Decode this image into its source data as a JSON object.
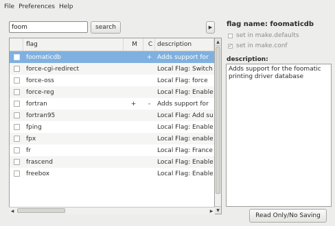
{
  "menu": {
    "file": "File",
    "preferences": "Preferences",
    "help": "Help"
  },
  "search": {
    "value": "foom",
    "button_label": "search"
  },
  "table": {
    "columns": [
      "flag",
      "M",
      "C",
      "description"
    ],
    "rows": [
      {
        "flag": "foomaticdb",
        "m": "",
        "c": "+",
        "desc": "Adds support for",
        "selected": true
      },
      {
        "flag": "force-cgi-redirect",
        "m": "",
        "c": "",
        "desc": "Local Flag: Switch"
      },
      {
        "flag": "force-oss",
        "m": "",
        "c": "",
        "desc": "Local Flag: force"
      },
      {
        "flag": "force-reg",
        "m": "",
        "c": "",
        "desc": "Local Flag: Enable"
      },
      {
        "flag": "fortran",
        "m": "+",
        "c": "-",
        "desc": "Adds support for"
      },
      {
        "flag": "fortran95",
        "m": "",
        "c": "",
        "desc": "Local Flag: Add su"
      },
      {
        "flag": "fping",
        "m": "",
        "c": "",
        "desc": "Local Flag: Enable"
      },
      {
        "flag": "fpx",
        "m": "",
        "c": "",
        "desc": "Local Flag: enable"
      },
      {
        "flag": "fr",
        "m": "",
        "c": "",
        "desc": "Local Flag: France"
      },
      {
        "flag": "frascend",
        "m": "",
        "c": "",
        "desc": "Local Flag: Enable"
      },
      {
        "flag": "freebox",
        "m": "",
        "c": "",
        "desc": "Local Flag: Enable"
      }
    ]
  },
  "side": {
    "title": "flag name: foomaticdb",
    "opt_defaults": "set in make.defaults",
    "opt_conf": "set in make.conf",
    "desc_label": "description:",
    "description": "Adds support for the foomatic printing driver database"
  },
  "bottom": {
    "readonly_label": "Read Only/No Saving"
  },
  "colors": {
    "selection": "#7fb0e0",
    "window_bg": "#ededeb"
  }
}
